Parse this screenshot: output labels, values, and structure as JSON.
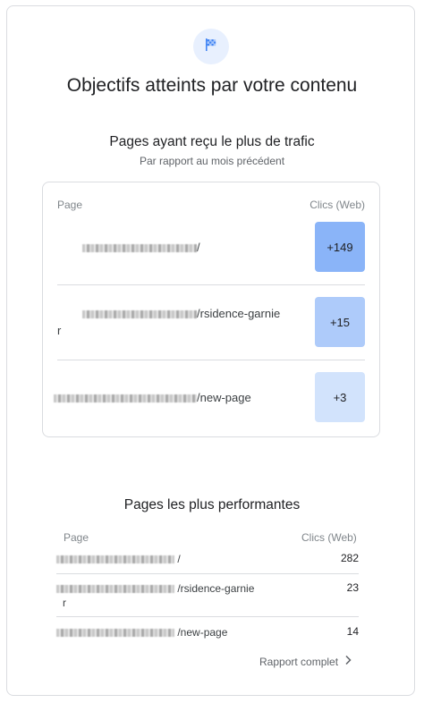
{
  "header": {
    "title": "Objectifs atteints par votre contenu",
    "icon": "flag-icon"
  },
  "top_pages": {
    "title": "Pages ayant reçu le plus de trafic",
    "subtitle": "Par rapport au mois précédent",
    "col_page": "Page",
    "col_clicks": "Clics (Web)",
    "rows": [
      {
        "url": "/",
        "value": "+149",
        "color": "#8ab4f8"
      },
      {
        "url": "/rsidence-garnie",
        "url_tail": "r",
        "value": "+15",
        "color": "#aecbfa"
      },
      {
        "url": "/new-page",
        "value": "+3",
        "color": "#d2e3fc"
      }
    ]
  },
  "best_pages": {
    "title": "Pages les plus performantes",
    "col_page": "Page",
    "col_clicks": "Clics (Web)",
    "rows": [
      {
        "url": "/",
        "value": "282"
      },
      {
        "url": "/rsidence-garnie",
        "url_tail": "r",
        "value": "23"
      },
      {
        "url": "/new-page",
        "value": "14"
      }
    ]
  },
  "footer": {
    "link_label": "Rapport complet",
    "icon": "chevron-right-icon"
  }
}
